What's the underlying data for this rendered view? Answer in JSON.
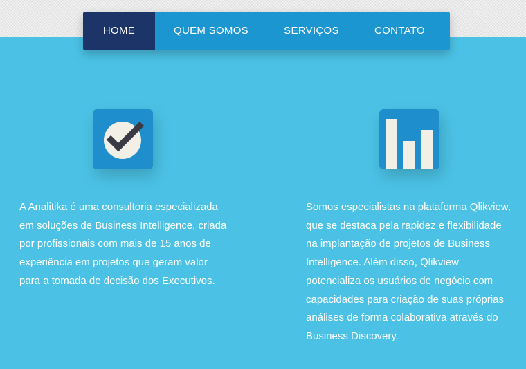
{
  "nav": {
    "items": [
      {
        "label": "HOME",
        "active": true
      },
      {
        "label": "QUEM SOMOS",
        "active": false
      },
      {
        "label": "SERVIÇOS",
        "active": false
      },
      {
        "label": "CONTATO",
        "active": false
      }
    ]
  },
  "features": [
    {
      "icon": "checkmark-icon",
      "lines": [
        "A Analitika é uma consultoria especializada",
        "em soluções de Business Intelligence, criada",
        "por profissionais com mais de 15 anos de",
        "experiência em projetos que geram valor",
        "para a tomada de decisão dos Executivos."
      ]
    },
    {
      "icon": "bar-chart-icon",
      "lines": [
        "Somos especialistas na plataforma Qlikview,",
        "que se destaca pela rapidez e flexibilidade",
        "na implantação de projetos de Business",
        "Intelligence. Além disso, Qlikview",
        "potencializa os usuários de negócio com",
        "capacidades para criação de suas próprias",
        "análises de forma colaborativa através do",
        "Business Discovery."
      ]
    }
  ],
  "colors": {
    "background": "#4bc2e5",
    "nav": "#1b96d1",
    "nav_active": "#1d3468",
    "icon_tile": "#1f8ecd"
  }
}
